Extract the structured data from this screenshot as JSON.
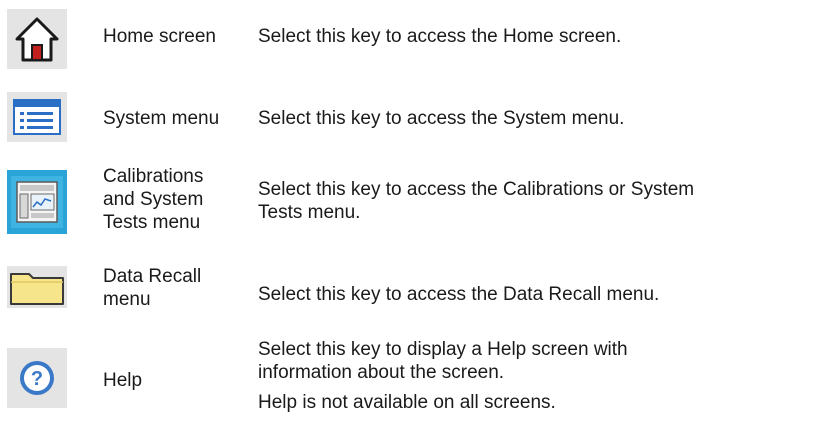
{
  "rows": [
    {
      "icon": "home-icon",
      "name": "Home screen",
      "description": "Select this key to access the Home screen."
    },
    {
      "icon": "system-menu-icon",
      "name": "System menu",
      "description": "Select this key to access the System menu."
    },
    {
      "icon": "calibrations-icon",
      "name_lines": [
        "Calibrations",
        "and System",
        "Tests menu"
      ],
      "description_lines": [
        "Select this key to access the Calibrations or System",
        "Tests menu."
      ]
    },
    {
      "icon": "folder-icon",
      "name_lines": [
        "Data Recall",
        "menu"
      ],
      "description": "Select this key to access the Data Recall menu."
    },
    {
      "icon": "help-icon",
      "name": "Help",
      "description_lines": [
        "Select this key to display a Help screen with",
        "information about the screen."
      ],
      "note": "Help is not available on all screens."
    }
  ],
  "colors": {
    "icon_background": "#e4e4e4",
    "window_blue": "#2a6ec6",
    "folder_yellow": "#f6e58a",
    "help_blue": "#3a78c8"
  }
}
